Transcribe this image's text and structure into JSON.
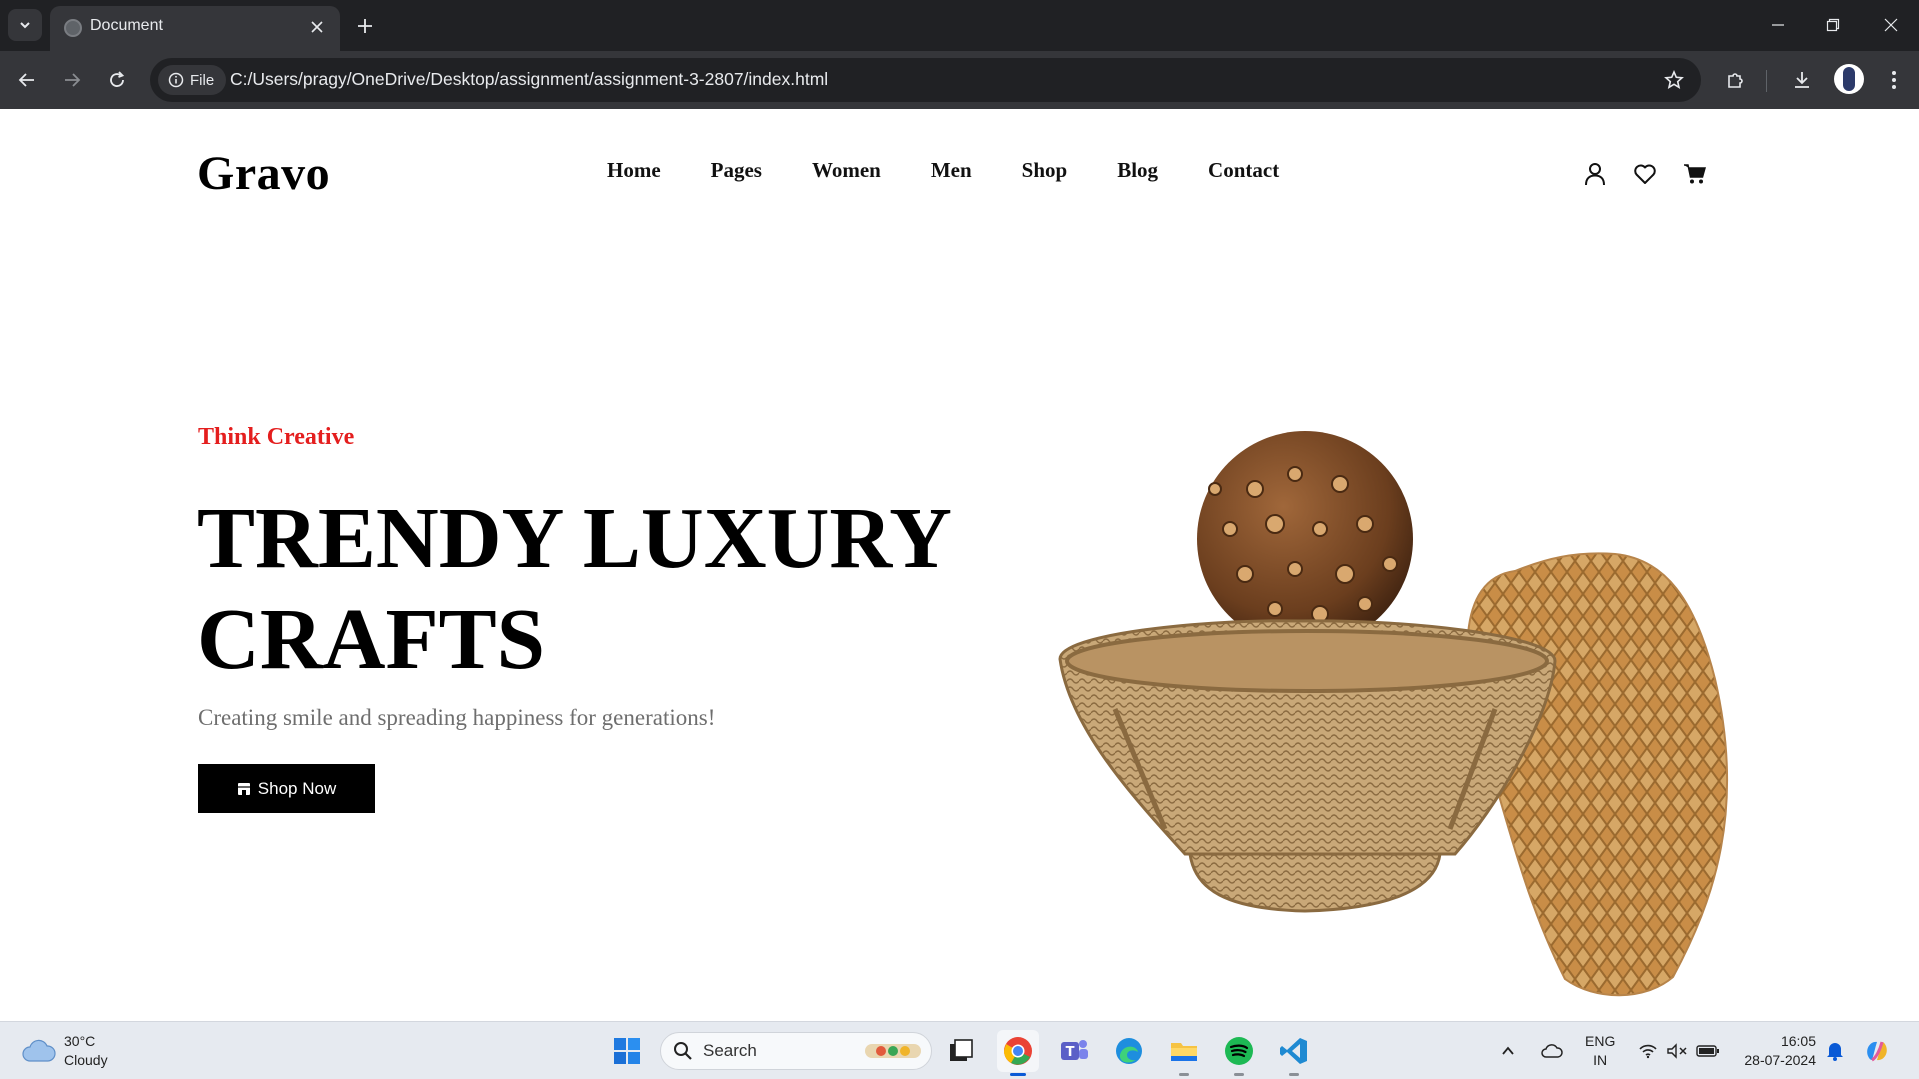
{
  "browser": {
    "tab_title": "Document",
    "file_chip_label": "File",
    "url": "C:/Users/pragy/OneDrive/Desktop/assignment/assignment-3-2807/index.html"
  },
  "site": {
    "logo": "Gravo",
    "nav": [
      "Home",
      "Pages",
      "Women",
      "Men",
      "Shop",
      "Blog",
      "Contact"
    ],
    "header_icons": [
      "user-icon",
      "heart-icon",
      "cart-icon"
    ]
  },
  "hero": {
    "eyebrow": "Think Creative",
    "headline_line1": "TRENDY LUXURY",
    "headline_line2": "CRAFTS",
    "subtitle": "Creating smile and spreading happiness for generations!",
    "button_label": "Shop Now",
    "accent_color": "#e41e1e"
  },
  "taskbar": {
    "weather_temp": "30°C",
    "weather_desc": "Cloudy",
    "search_label": "Search",
    "lang_line1": "ENG",
    "lang_line2": "IN",
    "time": "16:05",
    "date": "28-07-2024",
    "apps": [
      "start-icon",
      "search-icon",
      "task-view-icon",
      "chrome-icon",
      "teams-icon",
      "edge-icon",
      "file-explorer-icon",
      "spotify-icon",
      "vscode-icon"
    ]
  }
}
